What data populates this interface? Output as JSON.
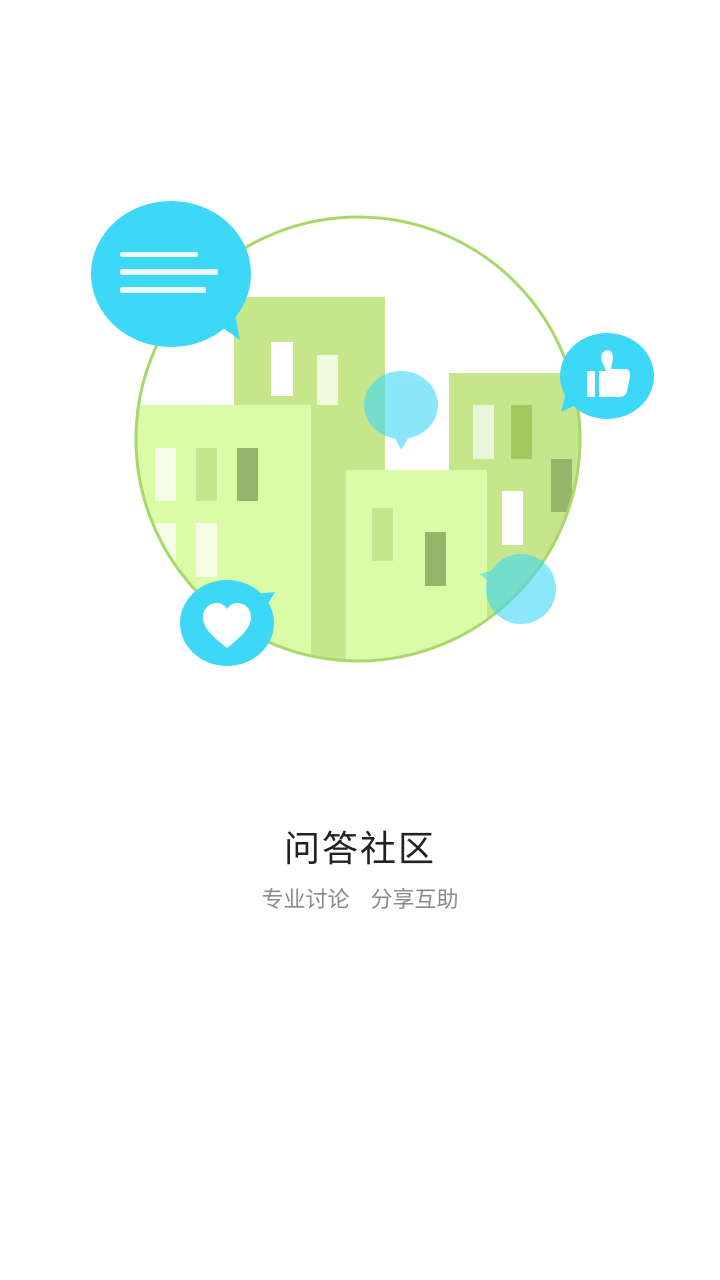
{
  "onboarding": {
    "title": "问答社区",
    "subtitle": "专业讨论   分享互助"
  },
  "illustration": {
    "icons": [
      "chat-bubble-lines-icon",
      "thumbs-up-icon",
      "heart-icon",
      "speech-bubble-icon"
    ],
    "colors": {
      "building_light": "#dbfca6",
      "building_mid": "#c6e68b",
      "window_dark": "#95b56a",
      "bubble_blue": "#3dd8f7",
      "ring": "#a8d86a"
    }
  }
}
